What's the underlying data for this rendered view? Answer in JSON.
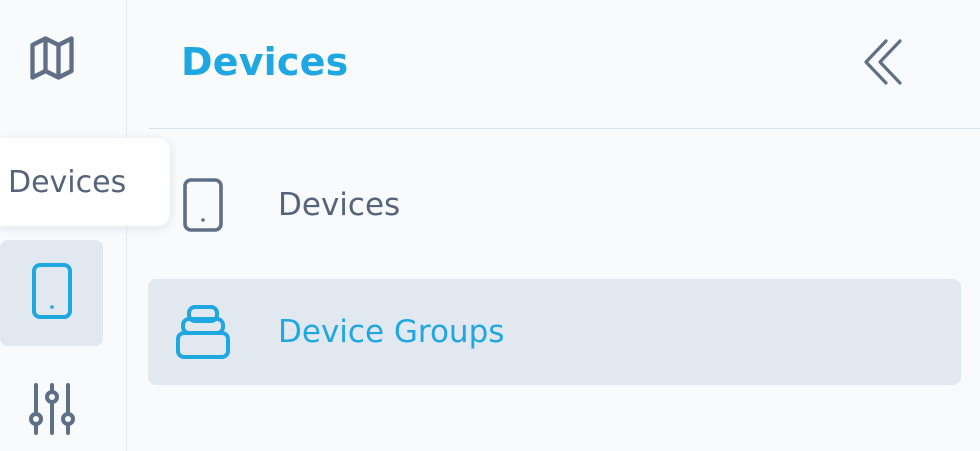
{
  "rail": {
    "items": [
      {
        "icon": "map-icon",
        "active": false
      },
      {
        "icon": "tablet-icon",
        "active": true
      },
      {
        "icon": "sliders-icon",
        "active": false
      }
    ],
    "tooltip": "Devices"
  },
  "panel": {
    "title": "Devices",
    "collapse_icon": "double-chevron-left-icon",
    "items": [
      {
        "label": "Devices",
        "icon": "tablet-icon",
        "active": false
      },
      {
        "label": "Device Groups",
        "icon": "stack-icon",
        "active": true
      }
    ]
  },
  "colors": {
    "accent": "#1ea7e1",
    "text": "#56637a",
    "active_bg": "#e2e8f0",
    "background": "#f8fafc"
  }
}
